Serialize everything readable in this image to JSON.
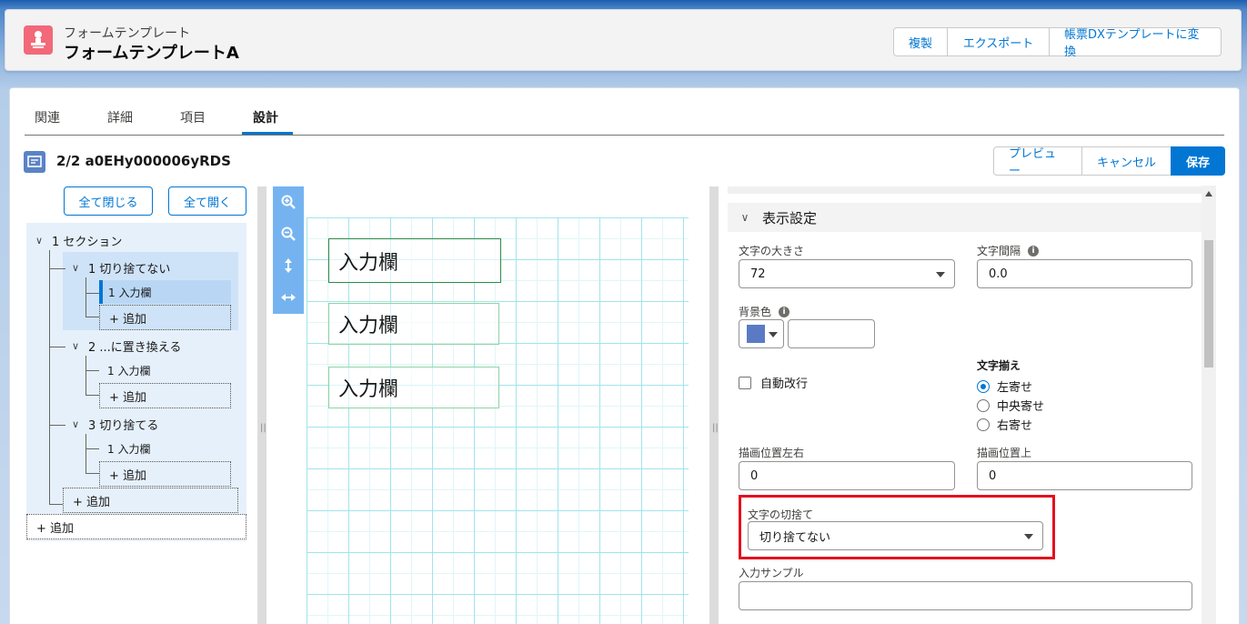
{
  "header": {
    "object_label": "フォームテンプレート",
    "record_name": "フォームテンプレートA",
    "icon": "form-template-icon",
    "buttons": [
      "複製",
      "エクスポート",
      "帳票DXテンプレートに変換"
    ]
  },
  "tabs": [
    {
      "label": "関連",
      "active": false
    },
    {
      "label": "詳細",
      "active": false
    },
    {
      "label": "項目",
      "active": false
    },
    {
      "label": "設計",
      "active": true
    }
  ],
  "record": {
    "title": "2/2 a0EHy000006yRDS",
    "buttons": {
      "preview": "プレビュー",
      "cancel": "キャンセル",
      "save": "保存"
    }
  },
  "outline": {
    "collapse_all": "全て閉じる",
    "expand_all": "全て開く",
    "section": "1 セクション",
    "groups": [
      {
        "label": "1 切り捨てない",
        "item": "1 入力欄",
        "add": "+ 追加"
      },
      {
        "label": "2 ...に置き換える",
        "item": "1 入力欄",
        "add": "+ 追加"
      },
      {
        "label": "3 切り捨てる",
        "item": "1 入力欄",
        "add": "+ 追加"
      }
    ],
    "section_add": "+ 追加",
    "root_add": "+ 追加"
  },
  "canvas": {
    "tools": [
      "zoom-in-icon",
      "zoom-out-icon",
      "fit-vertical-icon",
      "fit-horizontal-icon"
    ],
    "fields": [
      "入力欄",
      "入力欄",
      "入力欄"
    ]
  },
  "props": {
    "section_title": "表示設定",
    "font_size_label": "文字の大きさ",
    "font_size_value": "72",
    "letter_spacing_label": "文字間隔",
    "letter_spacing_value": "0.0",
    "bg_color_label": "背景色",
    "bg_color_swatch": "#5a7bc4",
    "bg_color_value": "",
    "auto_wrap_label": "自動改行",
    "align_label": "文字揃え",
    "align_options": [
      "左寄せ",
      "中央寄せ",
      "右寄せ"
    ],
    "align_selected": "左寄せ",
    "pos_x_label": "描画位置左右",
    "pos_x_value": "0",
    "pos_y_label": "描画位置上",
    "pos_y_value": "0",
    "truncate_label": "文字の切捨て",
    "truncate_value": "切り捨てない",
    "sample_label": "入力サンプル",
    "sample_value": ""
  },
  "colors": {
    "accent": "#0176d3",
    "highlight": "#e3101e",
    "icon_bg": "#f26979"
  }
}
